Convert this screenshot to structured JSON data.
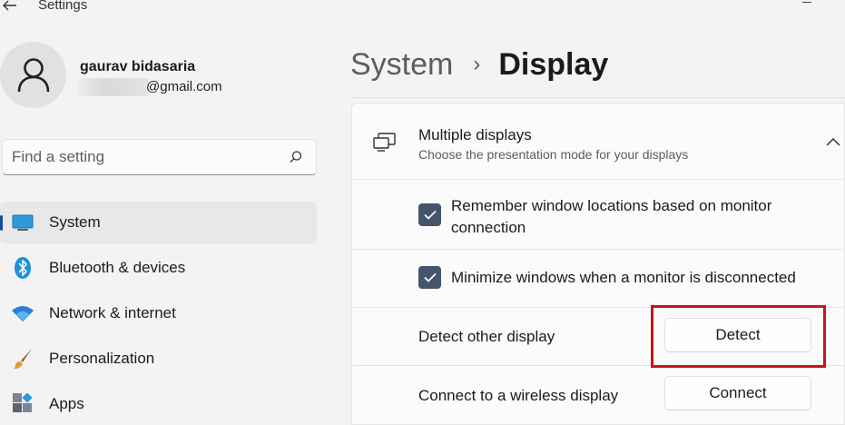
{
  "window": {
    "title": "Settings",
    "back_icon": "back-arrow-icon"
  },
  "user": {
    "name": "gaurav bidasaria",
    "email_visible": "@gmail.com"
  },
  "search": {
    "placeholder": "Find a setting",
    "value": ""
  },
  "sidebar": {
    "items": [
      {
        "label": "System",
        "icon": "monitor-icon",
        "selected": true
      },
      {
        "label": "Bluetooth & devices",
        "icon": "bluetooth-icon",
        "selected": false
      },
      {
        "label": "Network & internet",
        "icon": "wifi-icon",
        "selected": false
      },
      {
        "label": "Personalization",
        "icon": "brush-icon",
        "selected": false
      },
      {
        "label": "Apps",
        "icon": "apps-icon",
        "selected": false
      }
    ]
  },
  "breadcrumb": {
    "parent": "System",
    "separator": "›",
    "current": "Display"
  },
  "multiple_displays": {
    "title": "Multiple displays",
    "subtitle": "Choose the presentation mode for your displays",
    "expanded": true,
    "options": [
      {
        "label_line1": "Remember window locations based on monitor",
        "label_line2": "connection",
        "checked": true
      },
      {
        "label": "Minimize windows when a monitor is disconnected",
        "checked": true
      }
    ],
    "detect": {
      "label": "Detect other display",
      "button": "Detect"
    },
    "wireless": {
      "label": "Connect to a wireless display",
      "button": "Connect"
    }
  },
  "colors": {
    "accent": "#1a4aa0",
    "checkbox": "#44546a",
    "highlight": "#c4161c",
    "background": "#f3f3f3",
    "card": "#fbfbfb"
  }
}
